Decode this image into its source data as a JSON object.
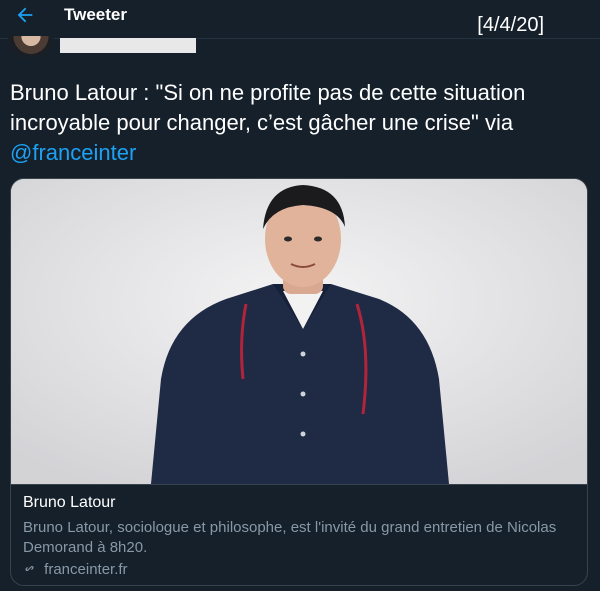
{
  "header": {
    "back_icon": "back-arrow-icon",
    "title": "Tweeter",
    "date_stamp": "[4/4/20]"
  },
  "tweet": {
    "text": "Bruno Latour : \"Si on ne profite pas de cette situation incroyable pour changer, c’est gâcher une crise\" via ",
    "mention": "@franceinter"
  },
  "card": {
    "title": "Bruno Latour",
    "description": "Bruno Latour, sociologue et philosophe, est l'invité du grand entretien de Nicolas Demorand à 8h20.",
    "domain": "franceinter.fr",
    "link_icon": "link-icon"
  },
  "colors": {
    "background": "#15202b",
    "accent": "#1da1f2",
    "muted": "#8899a6",
    "border": "#38444d"
  }
}
